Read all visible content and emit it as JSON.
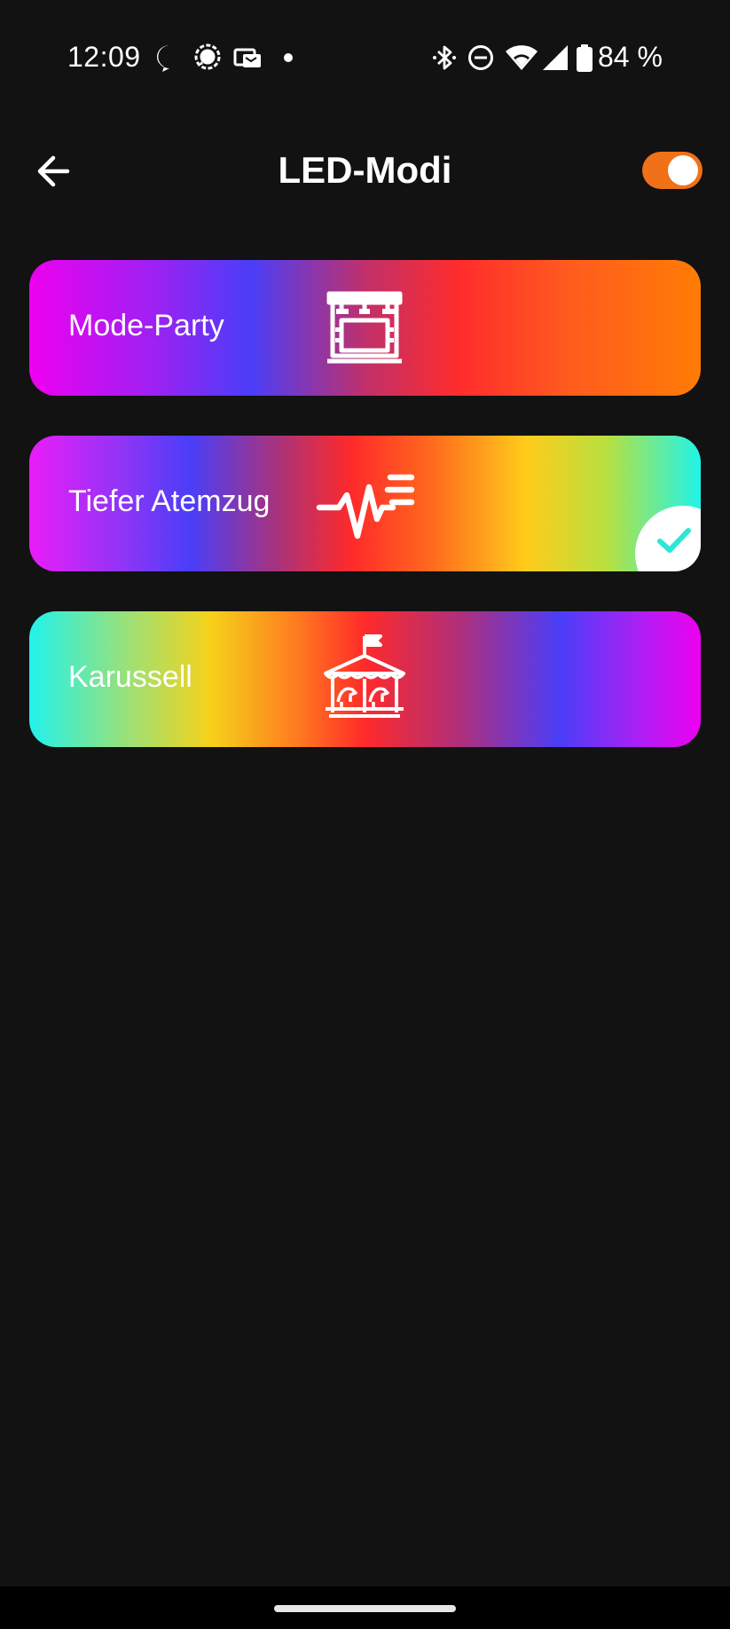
{
  "status_bar": {
    "time": "12:09",
    "battery_percent": "84 %",
    "notification_icons": [
      "lock-chat-icon",
      "signal-chat-icon",
      "payment-app-icon",
      "more-notifications-dot-icon"
    ],
    "system_icons": [
      "bluetooth-icon",
      "do-not-disturb-icon",
      "wifi-icon",
      "cell-signal-icon",
      "battery-icon"
    ]
  },
  "app_bar": {
    "title": "LED-Modi",
    "back_icon": "arrow-left-icon",
    "toggle_on": true,
    "toggle_color": "#f07118"
  },
  "modes": [
    {
      "label": "Mode-Party",
      "icon": "stage-lights-icon",
      "selected": false
    },
    {
      "label": "Tiefer Atemzug",
      "icon": "pulse-wave-icon",
      "selected": true
    },
    {
      "label": "Karussell",
      "icon": "carousel-icon",
      "selected": false
    }
  ],
  "colors": {
    "background": "#121212",
    "check_accent": "#2ee6d6"
  }
}
